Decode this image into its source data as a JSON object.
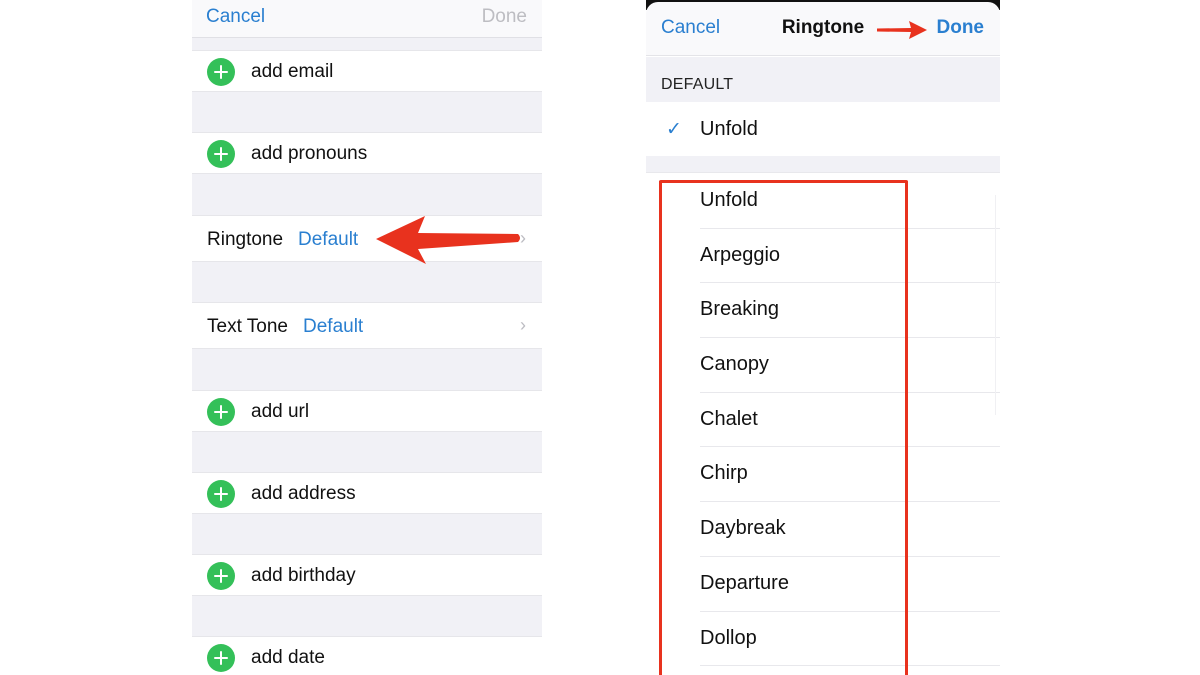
{
  "left_screen": {
    "nav": {
      "cancel_label": "Cancel",
      "done_label": "Done"
    },
    "rows": [
      {
        "type": "add",
        "label": "add email"
      },
      {
        "type": "add",
        "label": "add pronouns"
      },
      {
        "type": "setting",
        "key": "Ringtone",
        "value": "Default"
      },
      {
        "type": "setting",
        "key": "Text Tone",
        "value": "Default"
      },
      {
        "type": "add",
        "label": "add url"
      },
      {
        "type": "add",
        "label": "add address"
      },
      {
        "type": "add",
        "label": "add birthday"
      },
      {
        "type": "add",
        "label": "add date"
      }
    ],
    "icons": {
      "add": "plus-circle-icon",
      "disclosure": "chevron-right-icon"
    }
  },
  "right_screen": {
    "nav": {
      "cancel_label": "Cancel",
      "title": "Ringtone",
      "done_label": "Done"
    },
    "default_section": {
      "header": "DEFAULT",
      "selected": "Unfold",
      "check_icon": "checkmark-icon"
    },
    "tones": [
      "Unfold",
      "Arpeggio",
      "Breaking",
      "Canopy",
      "Chalet",
      "Chirp",
      "Daybreak",
      "Departure",
      "Dollop"
    ]
  },
  "annotations": {
    "ringtone_arrow": {
      "color": "#e8321e",
      "points_to": "Ringtone Default"
    },
    "done_arrow": {
      "color": "#e8321e",
      "points_to": "Done"
    },
    "tone_list_box": {
      "color": "#e8321e",
      "highlights": "ringtone list"
    }
  },
  "colors": {
    "ios_blue": "#2a7fd0",
    "ios_green": "#34c059",
    "group_background": "#f1f1f6",
    "disabled_gray": "#bdbdc2",
    "annotation_red": "#e8321e"
  }
}
